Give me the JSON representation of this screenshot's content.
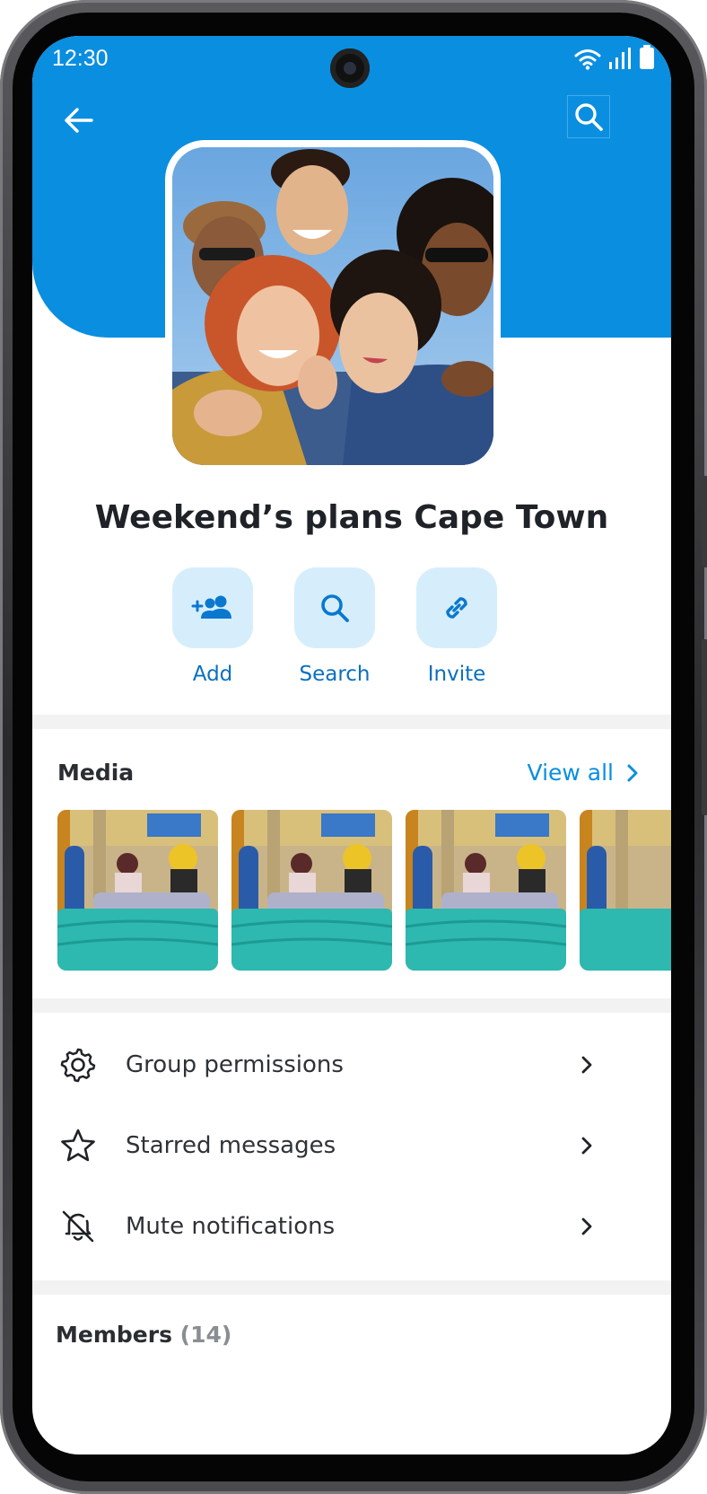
{
  "status_bar": {
    "time": "12:30"
  },
  "header": {
    "back_icon": "arrow-left-icon",
    "search_icon": "search-icon"
  },
  "group": {
    "title": "Weekend’s plans Cape Town"
  },
  "actions": [
    {
      "label": "Add",
      "icon": "add-people-icon"
    },
    {
      "label": "Search",
      "icon": "search-icon"
    },
    {
      "label": "Invite",
      "icon": "link-icon"
    }
  ],
  "media": {
    "title": "Media",
    "view_all": "View all"
  },
  "menu": [
    {
      "label": "Group permissions",
      "icon": "gear-icon"
    },
    {
      "label": "Starred messages",
      "icon": "star-icon"
    },
    {
      "label": "Mute notifications",
      "icon": "bell-off-icon"
    }
  ],
  "members": {
    "label": "Members",
    "count": "(14)"
  },
  "colors": {
    "accent": "#0a8ee0",
    "action_bg": "#d6eefc",
    "action_text": "#0a6fc0"
  }
}
